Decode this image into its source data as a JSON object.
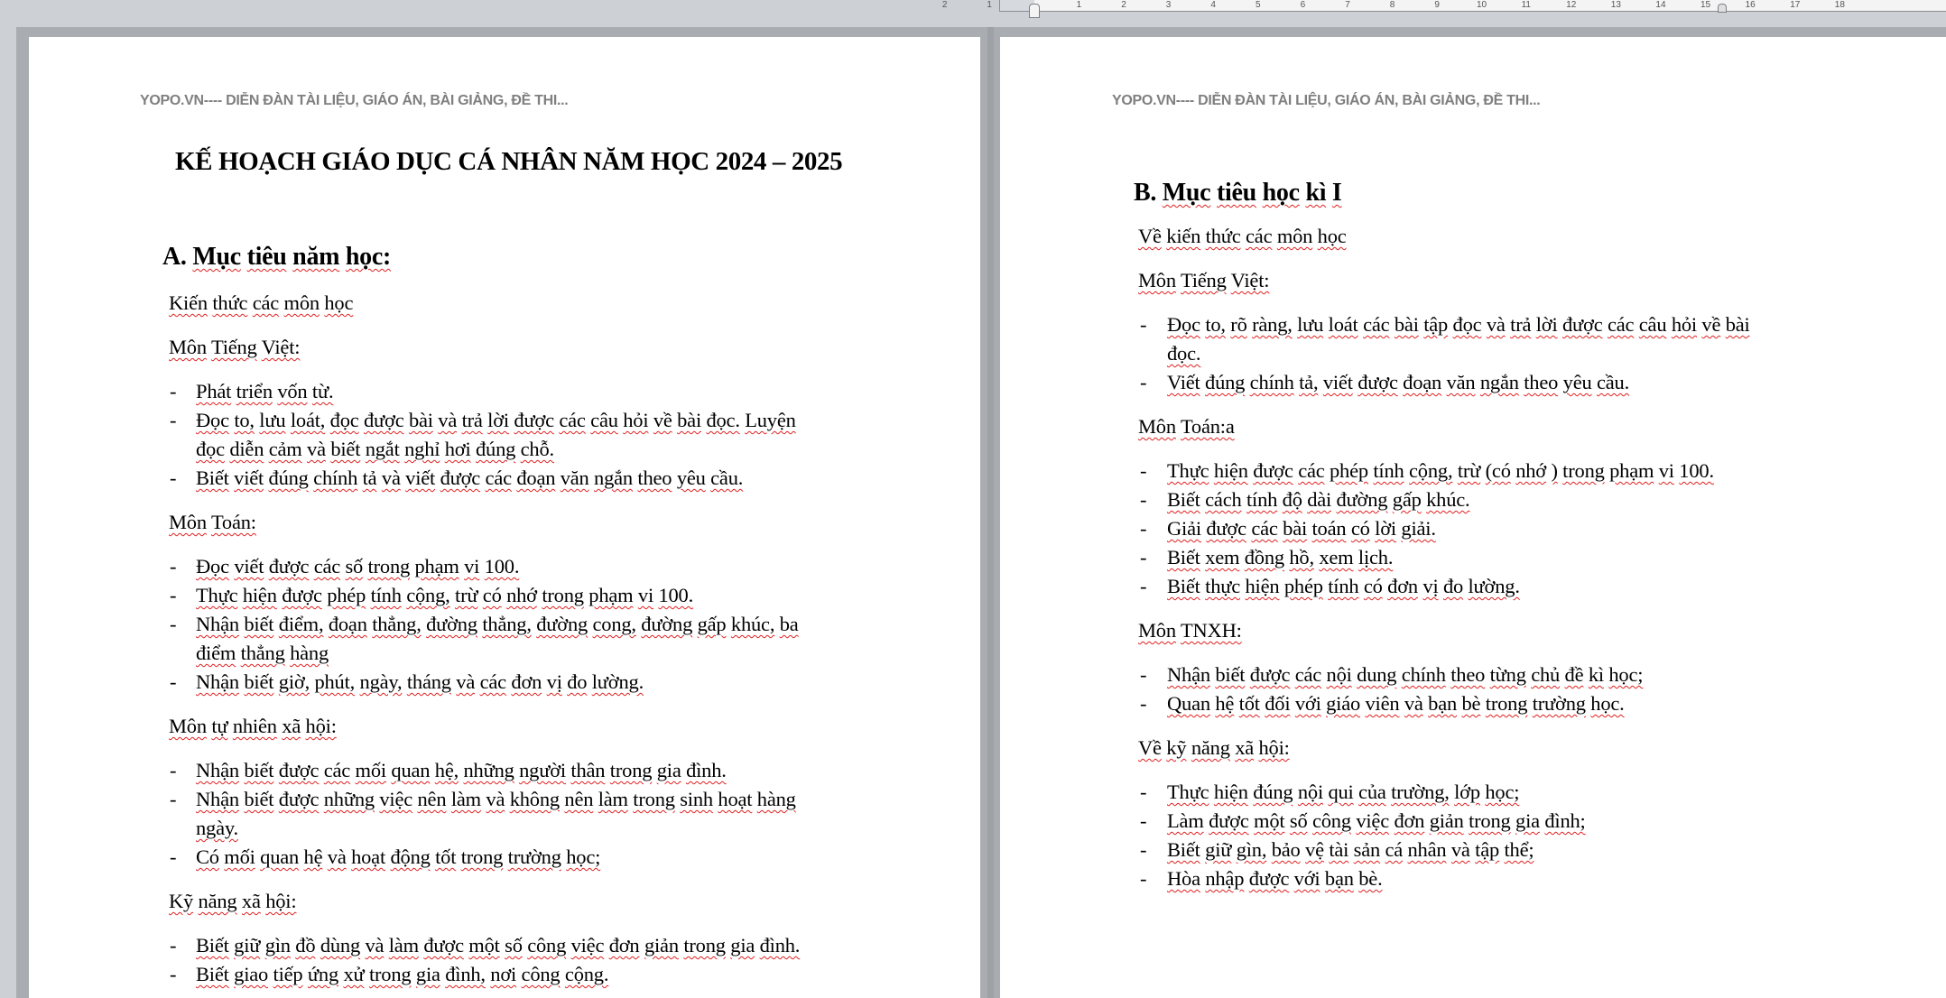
{
  "ruler": {
    "ticks_left": [
      "2",
      "1"
    ],
    "ticks": [
      "1",
      "2",
      "3",
      "4",
      "5",
      "6",
      "7",
      "8",
      "9",
      "10",
      "11",
      "12",
      "13",
      "14",
      "15",
      "16",
      "17",
      "18"
    ]
  },
  "pages": {
    "left": {
      "header": "YOPO.VN---- DIỄN ĐÀN TÀI LIỆU, GIÁO ÁN, BÀI GIẢNG, ĐỀ THI...",
      "title": "KẾ HOẠCH GIÁO DỤC CÁ NHÂN NĂM HỌC 2024 – 2025",
      "section_heading": "A. Mục tiêu năm học:",
      "lines": [
        {
          "type": "para",
          "text": "Kiến thức các môn học"
        },
        {
          "type": "para",
          "text": "Môn Tiếng Việt:"
        },
        {
          "type": "bullet",
          "text": "Phát triển vốn từ."
        },
        {
          "type": "bullet",
          "text": "Đọc to, lưu loát, đọc được bài và trả lời được các câu hỏi về bài đọc. Luyện"
        },
        {
          "type": "cont",
          "text": "đọc diễn cảm và biết ngắt nghỉ hơi đúng chỗ."
        },
        {
          "type": "bullet",
          "text": "Biết viết đúng chính tả và viết được các đoạn văn ngắn theo yêu cầu."
        },
        {
          "type": "para",
          "text": "Môn Toán:"
        },
        {
          "type": "bullet",
          "text": "Đọc viết được các số trong phạm vi 100."
        },
        {
          "type": "bullet",
          "text": "Thực hiện được phép tính cộng, trừ có nhớ trong phạm vi 100."
        },
        {
          "type": "bullet",
          "text": "Nhận biết điểm, đoạn thẳng, đường thẳng, đường cong, đường gấp khúc, ba"
        },
        {
          "type": "cont",
          "text": "điểm thẳng hàng"
        },
        {
          "type": "bullet",
          "text": "Nhận biết giờ, phút, ngày, tháng và các đơn vị đo lường."
        },
        {
          "type": "para",
          "text": "Môn tự nhiên xã hội:"
        },
        {
          "type": "bullet",
          "text": "Nhận biết được các mối quan hệ, những người thân trong gia đình."
        },
        {
          "type": "bullet",
          "text": "Nhận biết được những việc nên làm và không nên làm trong sinh hoạt hàng"
        },
        {
          "type": "cont",
          "text": "ngày."
        },
        {
          "type": "bullet",
          "text": "Có mối quan hệ và hoạt động tốt trong trường học;"
        },
        {
          "type": "para",
          "text": "Kỹ năng xã hội:"
        },
        {
          "type": "bullet",
          "text": "Biết giữ gìn đồ dùng và làm được một số công việc đơn giản trong gia đình."
        },
        {
          "type": "bullet",
          "text": "Biết giao tiếp ứng xử trong gia đình, nơi công cộng."
        }
      ]
    },
    "right": {
      "header": "YOPO.VN---- DIỄN ĐÀN TÀI LIỆU, GIÁO ÁN, BÀI GIẢNG, ĐỀ THI...",
      "section_heading": "B. Mục tiêu học kì I",
      "lines": [
        {
          "type": "para",
          "text": "Về kiến thức các môn học"
        },
        {
          "type": "para",
          "text": "Môn Tiếng Việt:"
        },
        {
          "type": "bullet",
          "text": "Đọc to, rõ ràng, lưu loát các bài tập đọc và trả lời được các câu hỏi về bài"
        },
        {
          "type": "cont",
          "text": "đọc."
        },
        {
          "type": "bullet",
          "text": "Viết đúng chính tả, viết được đoạn văn ngắn theo yêu cầu."
        },
        {
          "type": "para",
          "text": "Môn Toán:a"
        },
        {
          "type": "bullet",
          "text": "Thực hiện được các phép tính cộng, trừ (có nhớ ) trong phạm vi 100."
        },
        {
          "type": "bullet",
          "text": "Biết cách tính độ dài đường gấp khúc."
        },
        {
          "type": "bullet",
          "text": "Giải được các bài toán có lời giải."
        },
        {
          "type": "bullet",
          "text": "Biết xem đồng hồ, xem lịch."
        },
        {
          "type": "bullet",
          "text": "Biết thực hiện phép tính có đơn vị đo lường."
        },
        {
          "type": "para",
          "text": "Môn TNXH:"
        },
        {
          "type": "bullet",
          "text": "Nhận biết được các nội dung chính theo từng chủ đề kì học;"
        },
        {
          "type": "bullet",
          "text": "Quan hệ tốt đối với giáo viên và bạn bè trong trường học."
        },
        {
          "type": "para",
          "text": "Về kỹ năng xã hội:"
        },
        {
          "type": "bullet",
          "text": "Thực hiện đúng nội qui của trường, lớp học;"
        },
        {
          "type": "bullet",
          "text": "Làm được một số công việc đơn giản trong gia đình;"
        },
        {
          "type": "bullet",
          "text": "Biết giữ gìn, bảo vệ tài sản cá nhân và tập thể;"
        },
        {
          "type": "bullet",
          "text": "Hòa nhập được với bạn bè."
        }
      ]
    }
  },
  "bullet_glyph": "-"
}
